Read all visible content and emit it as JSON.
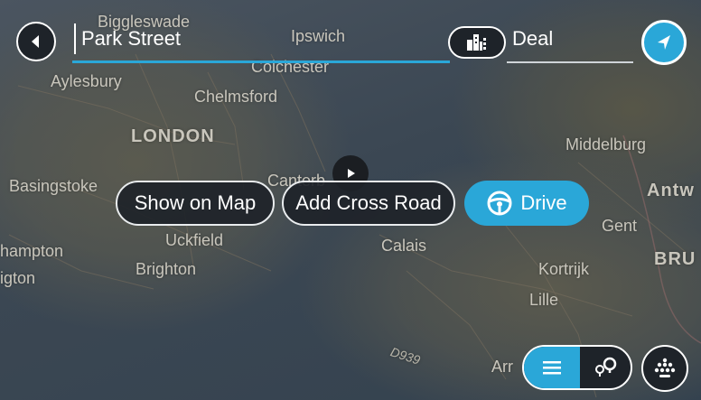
{
  "search": {
    "query": "Park Street",
    "location": "Deal"
  },
  "actions": {
    "show_on_map": "Show on Map",
    "add_cross_road": "Add Cross Road",
    "drive": "Drive"
  },
  "map": {
    "places": {
      "biggleswade": "Biggleswade",
      "ipswich": "Ipswich",
      "colchester": "Colchester",
      "aylesbury": "Aylesbury",
      "chelmsford": "Chelmsford",
      "london": "LONDON",
      "middelburg": "Middelburg",
      "basingstoke": "Basingstoke",
      "canterbury": "Canterb",
      "antwerp": "Antw",
      "gent": "Gent",
      "uckfield": "Uckfield",
      "calais": "Calais",
      "hampton": "hampton",
      "brighton": "Brighton",
      "kortrijk": "Kortrijk",
      "bru": "BRU",
      "igton": "igton",
      "lille": "Lille",
      "d939": "D939",
      "arras": "Arr"
    }
  },
  "colors": {
    "accent": "#2aa7d8",
    "button_dark": "#1e2329",
    "text": "#ffffff"
  },
  "icons": {
    "back": "back-arrow-icon",
    "places": "city-buildings-icon",
    "navigate": "navigation-arrow-icon",
    "drive": "steering-wheel-icon",
    "list": "list-icon",
    "map_pins": "map-pins-icon",
    "keyboard": "keyboard-icon",
    "play": "play-icon"
  }
}
